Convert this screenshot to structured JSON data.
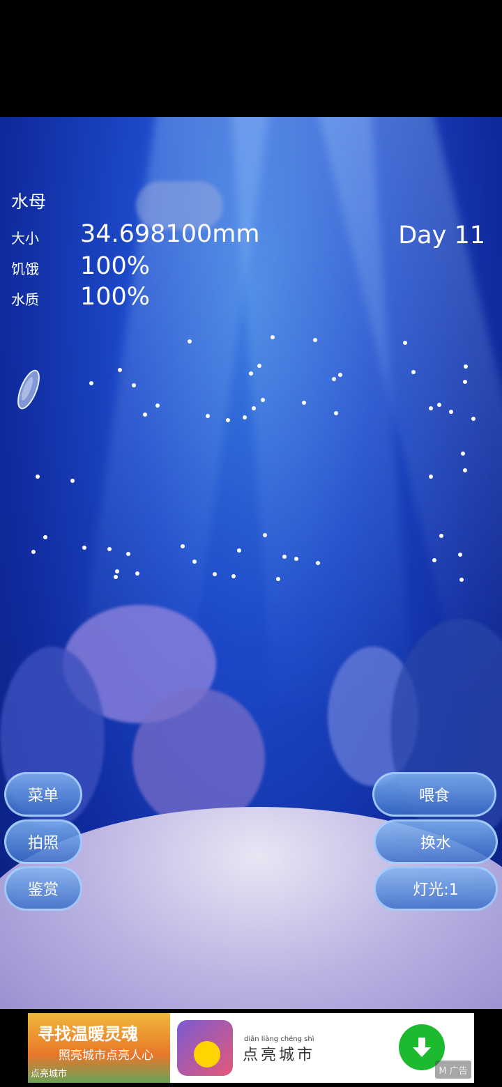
{
  "hud": {
    "title": "水母",
    "size_label": "大小",
    "size_value": "34.698100mm",
    "hunger_label": "饥饿",
    "hunger_value": "100%",
    "water_label": "水质",
    "water_value": "100%",
    "day": "Day 11"
  },
  "buttons_left": {
    "menu": "菜单",
    "photo": "拍照",
    "appreciate": "鉴赏"
  },
  "buttons_right": {
    "feed": "喂食",
    "change_water": "换水",
    "light": "灯光:1"
  },
  "ad": {
    "banner_headline": "寻找温暖灵魂",
    "banner_subline": "照亮城市点亮人心",
    "banner_small": "点亮城市",
    "app_pinyin": "diǎn liàng chéng shì",
    "app_name": "点亮城市",
    "mark": "M 广告"
  },
  "icons": [
    "jellyfish-icon",
    "download-icon",
    "app-icon"
  ]
}
